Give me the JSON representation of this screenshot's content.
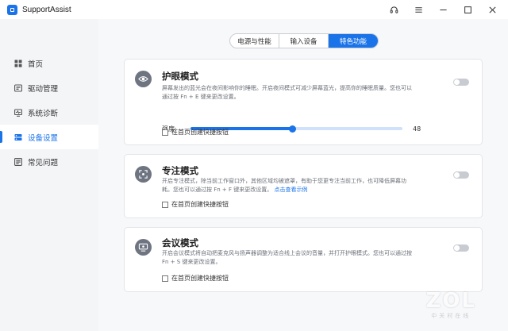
{
  "app": {
    "title": "SupportAssist"
  },
  "window_controls": [
    {
      "name": "headset-icon"
    },
    {
      "name": "menu-icon"
    },
    {
      "name": "minimize-icon"
    },
    {
      "name": "maximize-icon"
    },
    {
      "name": "close-icon"
    }
  ],
  "sidebar": {
    "items": [
      {
        "label": "首页",
        "icon": "home-grid-icon",
        "active": false
      },
      {
        "label": "驱动管理",
        "icon": "driver-icon",
        "active": false
      },
      {
        "label": "系统诊断",
        "icon": "diagnostic-icon",
        "active": false
      },
      {
        "label": "设备设置",
        "icon": "device-settings-icon",
        "active": true
      },
      {
        "label": "常见问题",
        "icon": "faq-icon",
        "active": false
      }
    ]
  },
  "tabs": [
    {
      "label": "电源与性能",
      "active": false
    },
    {
      "label": "输入设备",
      "active": false
    },
    {
      "label": "特色功能",
      "active": true
    }
  ],
  "cards": {
    "eye_care": {
      "title": "护眼模式",
      "icon": "eye-icon",
      "desc_line1": "屏幕发出的蓝光会在夜间影响你的睡眠。开启夜间模式可减少屏幕蓝光，提高你的睡眠质量。您也可以",
      "desc_line2": "通过按 Fn + E 键来更改设置。",
      "toggle_on": false,
      "slider_label": "强度:",
      "slider_value": "48",
      "slider_fraction": 0.48,
      "shortcut_label": "在首页创建快捷按钮"
    },
    "focus": {
      "title": "专注模式",
      "icon": "focus-icon",
      "desc_line1": "开启专注模式，除当前工作窗口外，其他区域均被遮罩，有助于您更专注当前工作，也可降低屏幕功",
      "desc_line2": "耗。您也可以通过按 Fn + F 键来更改设置。",
      "link": "点击查看示例",
      "toggle_on": false,
      "shortcut_label": "在首页创建快捷按钮"
    },
    "meeting": {
      "title": "会议模式",
      "icon": "meeting-icon",
      "desc_line1": "开启会议模式将自动把麦克风与扬声器调整为适合线上会议的音量，并打开护眼模式。您也可以通过按",
      "desc_line2": "Fn + S 键来更改设置。",
      "toggle_on": false,
      "shortcut_label": "在首页创建快捷按钮"
    }
  },
  "watermark": {
    "main": "ZOL",
    "sub": "中关村在线"
  },
  "colors": {
    "accent": "#1a73e8",
    "toggle_off": "#c8ccd2",
    "icon_bg": "#6e7480"
  }
}
